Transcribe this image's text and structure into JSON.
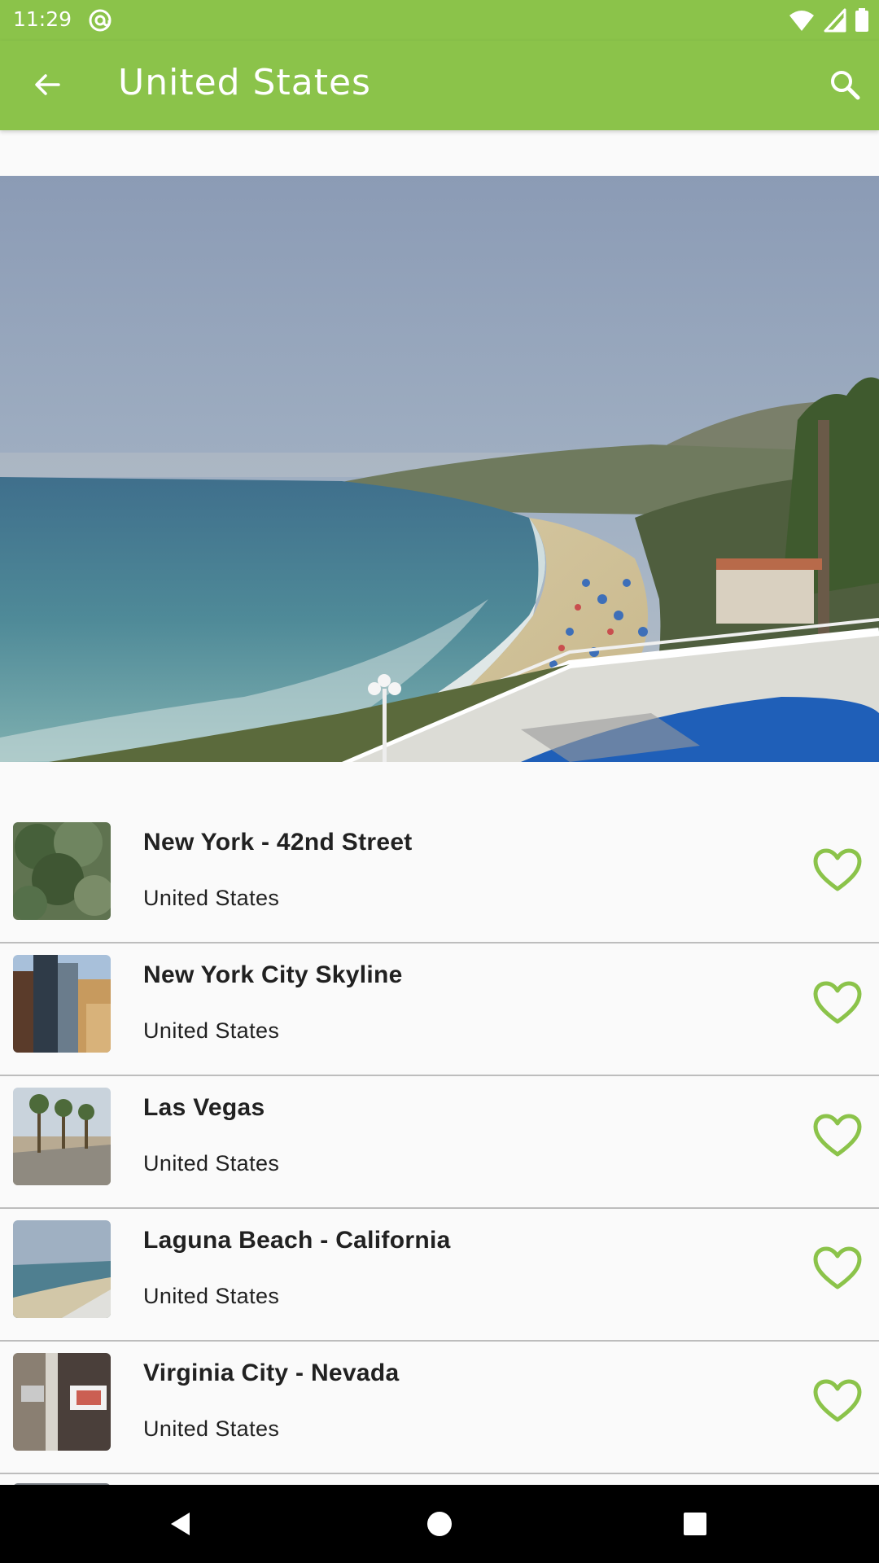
{
  "status_bar": {
    "time": "11:29",
    "icons": [
      "at-sign-icon",
      "wifi-icon",
      "signal-icon",
      "battery-icon"
    ]
  },
  "app_bar": {
    "title": "United States",
    "back_icon": "arrow-left-icon",
    "search_icon": "search-icon",
    "background_color": "#8bc34a"
  },
  "hero": {
    "image": "laguna-beach-webcam-photo"
  },
  "webcams": [
    {
      "title": "New York - 42nd Street",
      "subtitle": "United States",
      "favorite_icon": "heart-outline-icon"
    },
    {
      "title": "New York City Skyline",
      "subtitle": "United States",
      "favorite_icon": "heart-outline-icon"
    },
    {
      "title": "Las Vegas",
      "subtitle": "United States",
      "favorite_icon": "heart-outline-icon"
    },
    {
      "title": "Laguna Beach - California",
      "subtitle": "United States",
      "favorite_icon": "heart-outline-icon"
    },
    {
      "title": "Virginia City - Nevada",
      "subtitle": "United States",
      "favorite_icon": "heart-outline-icon"
    }
  ],
  "nav_bar": {
    "buttons": [
      "back-triangle-icon",
      "home-circle-icon",
      "recents-square-icon"
    ]
  },
  "colors": {
    "accent": "#8bc34a",
    "text": "#212121",
    "divider": "#bdbdbd"
  }
}
